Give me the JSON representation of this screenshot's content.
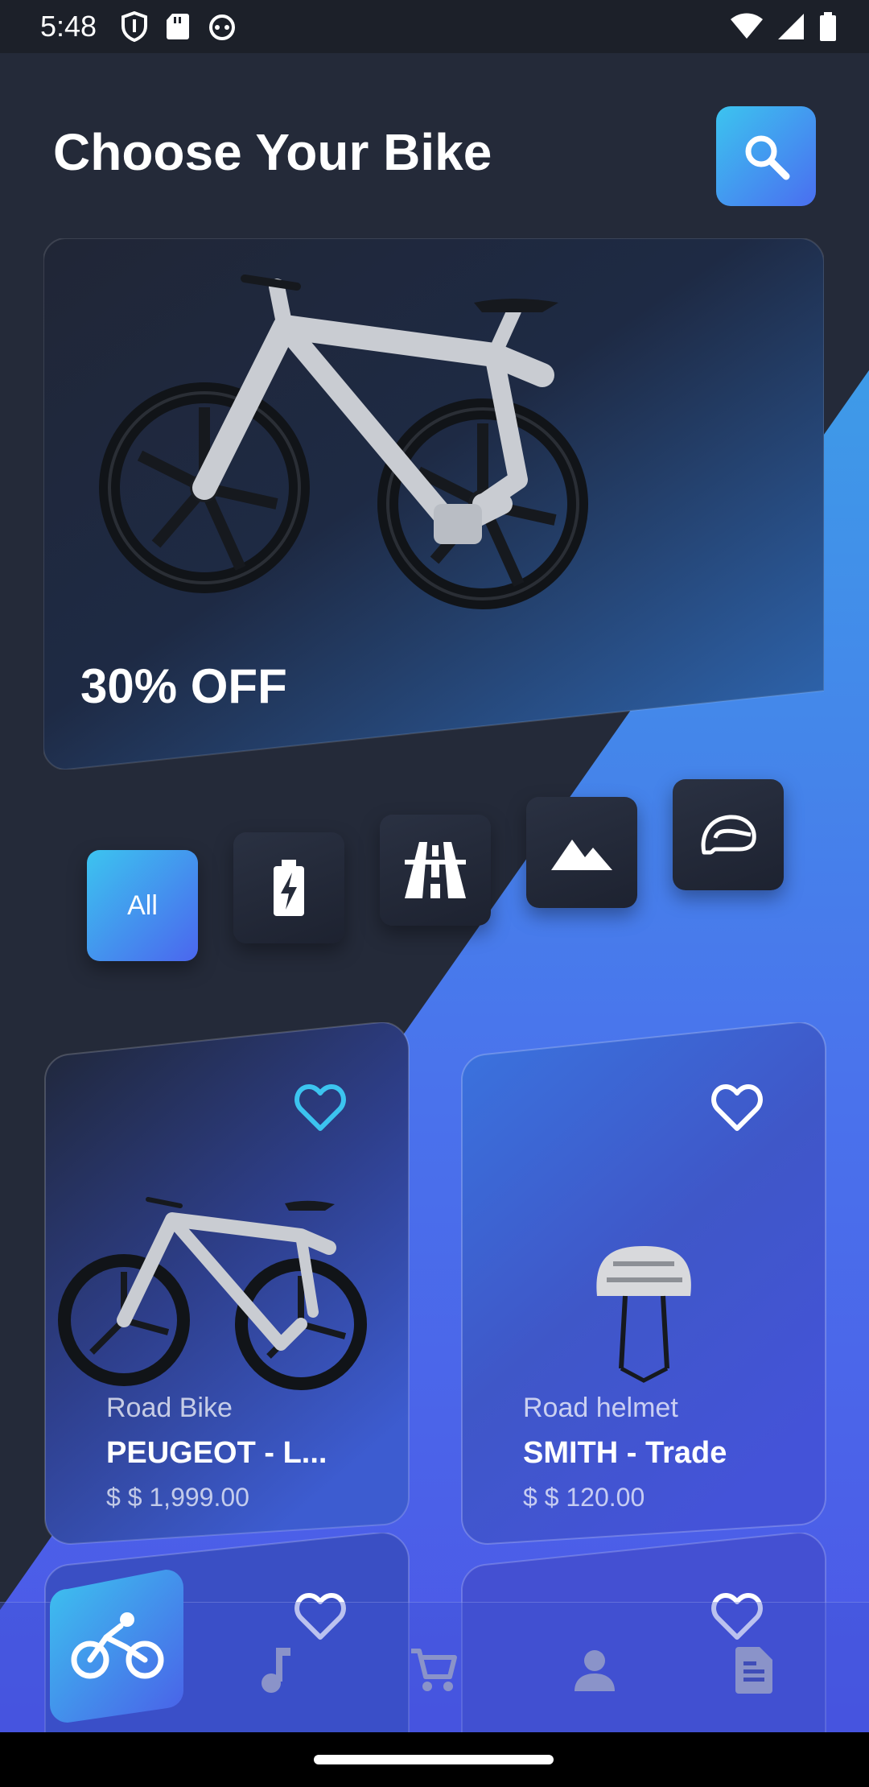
{
  "status_bar": {
    "time": "5:48"
  },
  "header": {
    "title": "Choose Your Bike"
  },
  "hero": {
    "discount": "30% OFF"
  },
  "categories": [
    {
      "label": "All",
      "icon": "all",
      "active": true
    },
    {
      "label": "",
      "icon": "battery-bolt-icon",
      "active": false
    },
    {
      "label": "",
      "icon": "road-icon",
      "active": false
    },
    {
      "label": "",
      "icon": "mountain-icon",
      "active": false
    },
    {
      "label": "",
      "icon": "helmet-icon",
      "active": false
    }
  ],
  "products": [
    {
      "type": "Road Bike",
      "name": "PEUGEOT - L...",
      "price": "$ $ 1,999.00",
      "favorite_color": "#3cc4ef"
    },
    {
      "type": "Road helmet",
      "name": "SMITH - Trade",
      "price": "$ $ 120.00",
      "favorite_color": "#ffffff"
    }
  ],
  "bottom_nav": [
    {
      "icon": "bike-icon",
      "active": true
    },
    {
      "icon": "music-icon",
      "active": false
    },
    {
      "icon": "cart-icon",
      "active": false
    },
    {
      "icon": "person-icon",
      "active": false
    },
    {
      "icon": "document-icon",
      "active": false
    }
  ],
  "colors": {
    "background": "#242a39",
    "accent_cyan": "#3cc4ef",
    "accent_blue": "#4a6ef0"
  }
}
